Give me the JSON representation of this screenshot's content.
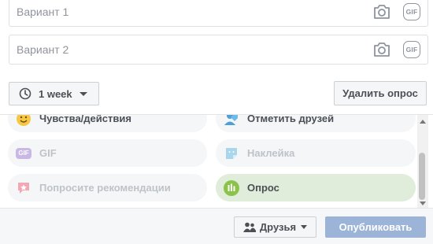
{
  "poll": {
    "option1_placeholder": "Вариант 1",
    "option2_placeholder": "Вариант 2",
    "gif_label": "GIF",
    "duration_label": "1 week",
    "delete_label": "Удалить опрос"
  },
  "composer_options": [
    {
      "label": "Чувства/действия",
      "icon": "smiley-icon"
    },
    {
      "label": "Отметить друзей",
      "icon": "tag-friends-icon"
    },
    {
      "label": "GIF",
      "icon": "gif-icon"
    },
    {
      "label": "Наклейка",
      "icon": "sticker-icon"
    },
    {
      "label": "Попросите рекомендации",
      "icon": "recommendation-icon"
    },
    {
      "label": "Опрос",
      "icon": "poll-icon"
    }
  ],
  "footer": {
    "audience_label": "Друзья",
    "publish_label": "Опубликовать"
  },
  "colors": {
    "publish_bg": "#9cb4d8",
    "poll_active_bg": "#e1eddb",
    "poll_icon": "#8bc34a"
  }
}
